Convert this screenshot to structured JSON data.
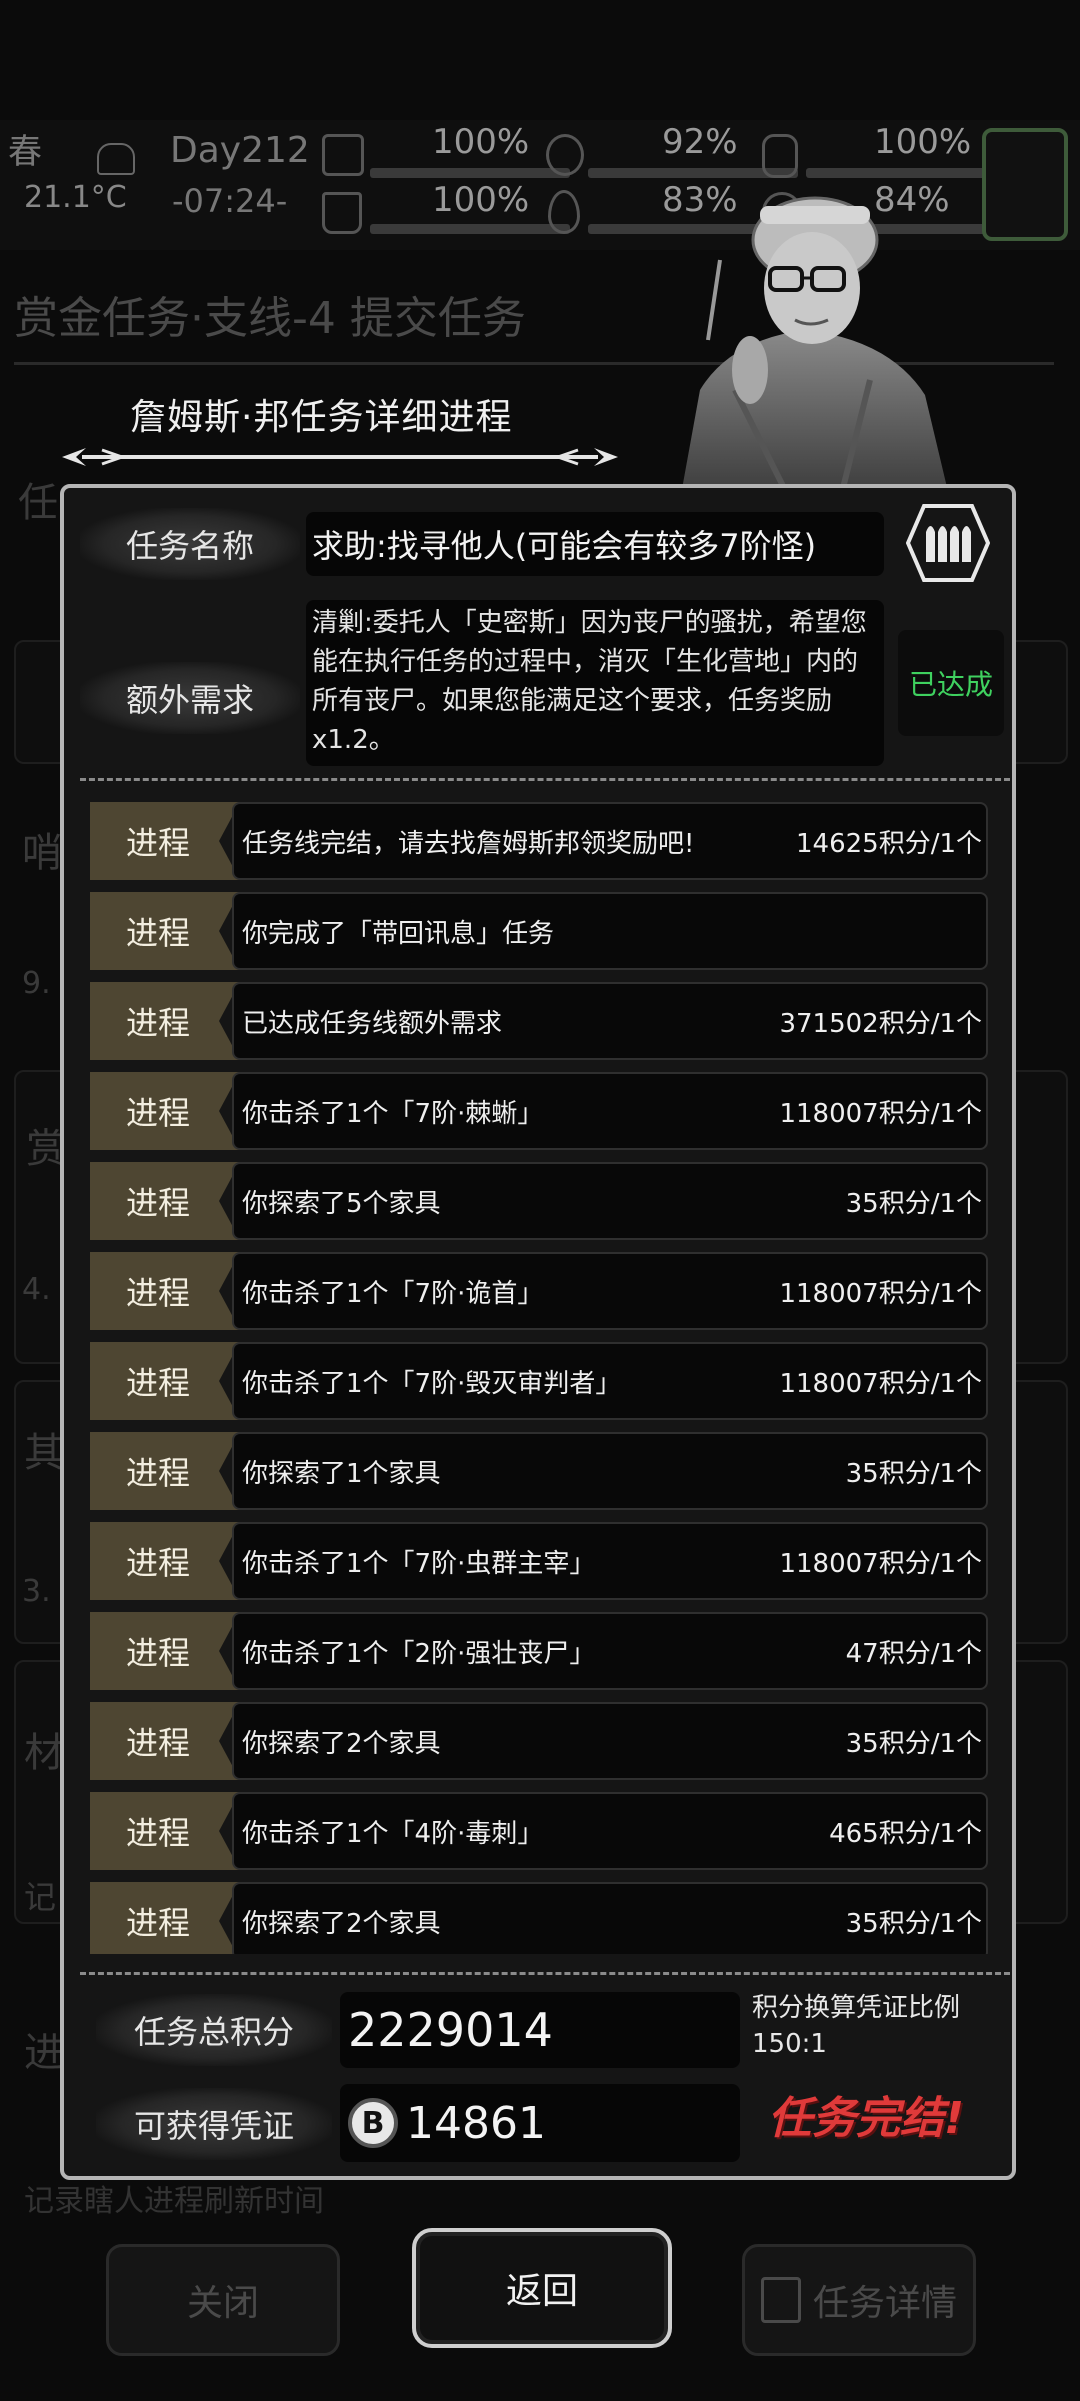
{
  "hud": {
    "season": "春",
    "temperature": "21.1°C",
    "day": "Day212",
    "time": "-07:24-",
    "stats": [
      {
        "icon": "medkit-icon",
        "value": "100%"
      },
      {
        "icon": "stomach-icon",
        "value": "92%"
      },
      {
        "icon": "bladder-icon",
        "value": "100%"
      },
      {
        "icon": "boot-icon",
        "value": "100%"
      },
      {
        "icon": "water-drop-icon",
        "value": "83%"
      },
      {
        "icon": "mood-icon",
        "value": "84%"
      }
    ]
  },
  "background": {
    "title": "赏金任务·支线-4 提交任务",
    "side_chars": [
      "任",
      "哨",
      "9.",
      "赏",
      "4.",
      "其",
      "3.",
      "材",
      "记",
      "进"
    ],
    "bottom_left_label": "关闭",
    "bottom_right_label": "任务详情",
    "faded_footer": "记录瞎人进程刷新时间"
  },
  "dialog": {
    "title": "詹姆斯·邦任务详细进程",
    "task_name_label": "任务名称",
    "task_name": "求助:找寻他人(可能会有较多7阶怪)",
    "extra_label": "额外需求",
    "extra_text": "清剿:委托人「史密斯」因为丧尸的骚扰，希望您能在执行任务的过程中，消灭「生化营地」内的所有丧尸。如果您能满足这个要求，任务奖励 x1.2。",
    "extra_status": "已达成",
    "progress_tag": "进程",
    "rows": [
      {
        "text": "任务线完结，请去找詹姆斯邦领奖励吧!",
        "points": "14625积分/1个"
      },
      {
        "text": "你完成了「带回讯息」任务",
        "points": ""
      },
      {
        "text": "已达成任务线额外需求",
        "points": "371502积分/1个"
      },
      {
        "text": "你击杀了1个「7阶·棘蜥」",
        "points": "118007积分/1个"
      },
      {
        "text": "你探索了5个家具",
        "points": "35积分/1个"
      },
      {
        "text": "你击杀了1个「7阶·诡首」",
        "points": "118007积分/1个"
      },
      {
        "text": "你击杀了1个「7阶·毁灭审判者」",
        "points": "118007积分/1个"
      },
      {
        "text": "你探索了1个家具",
        "points": "35积分/1个"
      },
      {
        "text": "你击杀了1个「7阶·虫群主宰」",
        "points": "118007积分/1个"
      },
      {
        "text": "你击杀了1个「2阶·强壮丧尸」",
        "points": "47积分/1个"
      },
      {
        "text": "你探索了2个家具",
        "points": "35积分/1个"
      },
      {
        "text": "你击杀了1个「4阶·毒刺」",
        "points": "465积分/1个"
      },
      {
        "text": "你探索了2个家具",
        "points": "35积分/1个"
      }
    ],
    "total_label": "任务总积分",
    "total_value": "2229014",
    "ratio_label": "积分换算凭证比例",
    "ratio_value": "150:1",
    "voucher_label": "可获得凭证",
    "voucher_value": "14861",
    "coin_symbol": "B",
    "complete_text": "任务完结!",
    "return_label": "返回"
  }
}
